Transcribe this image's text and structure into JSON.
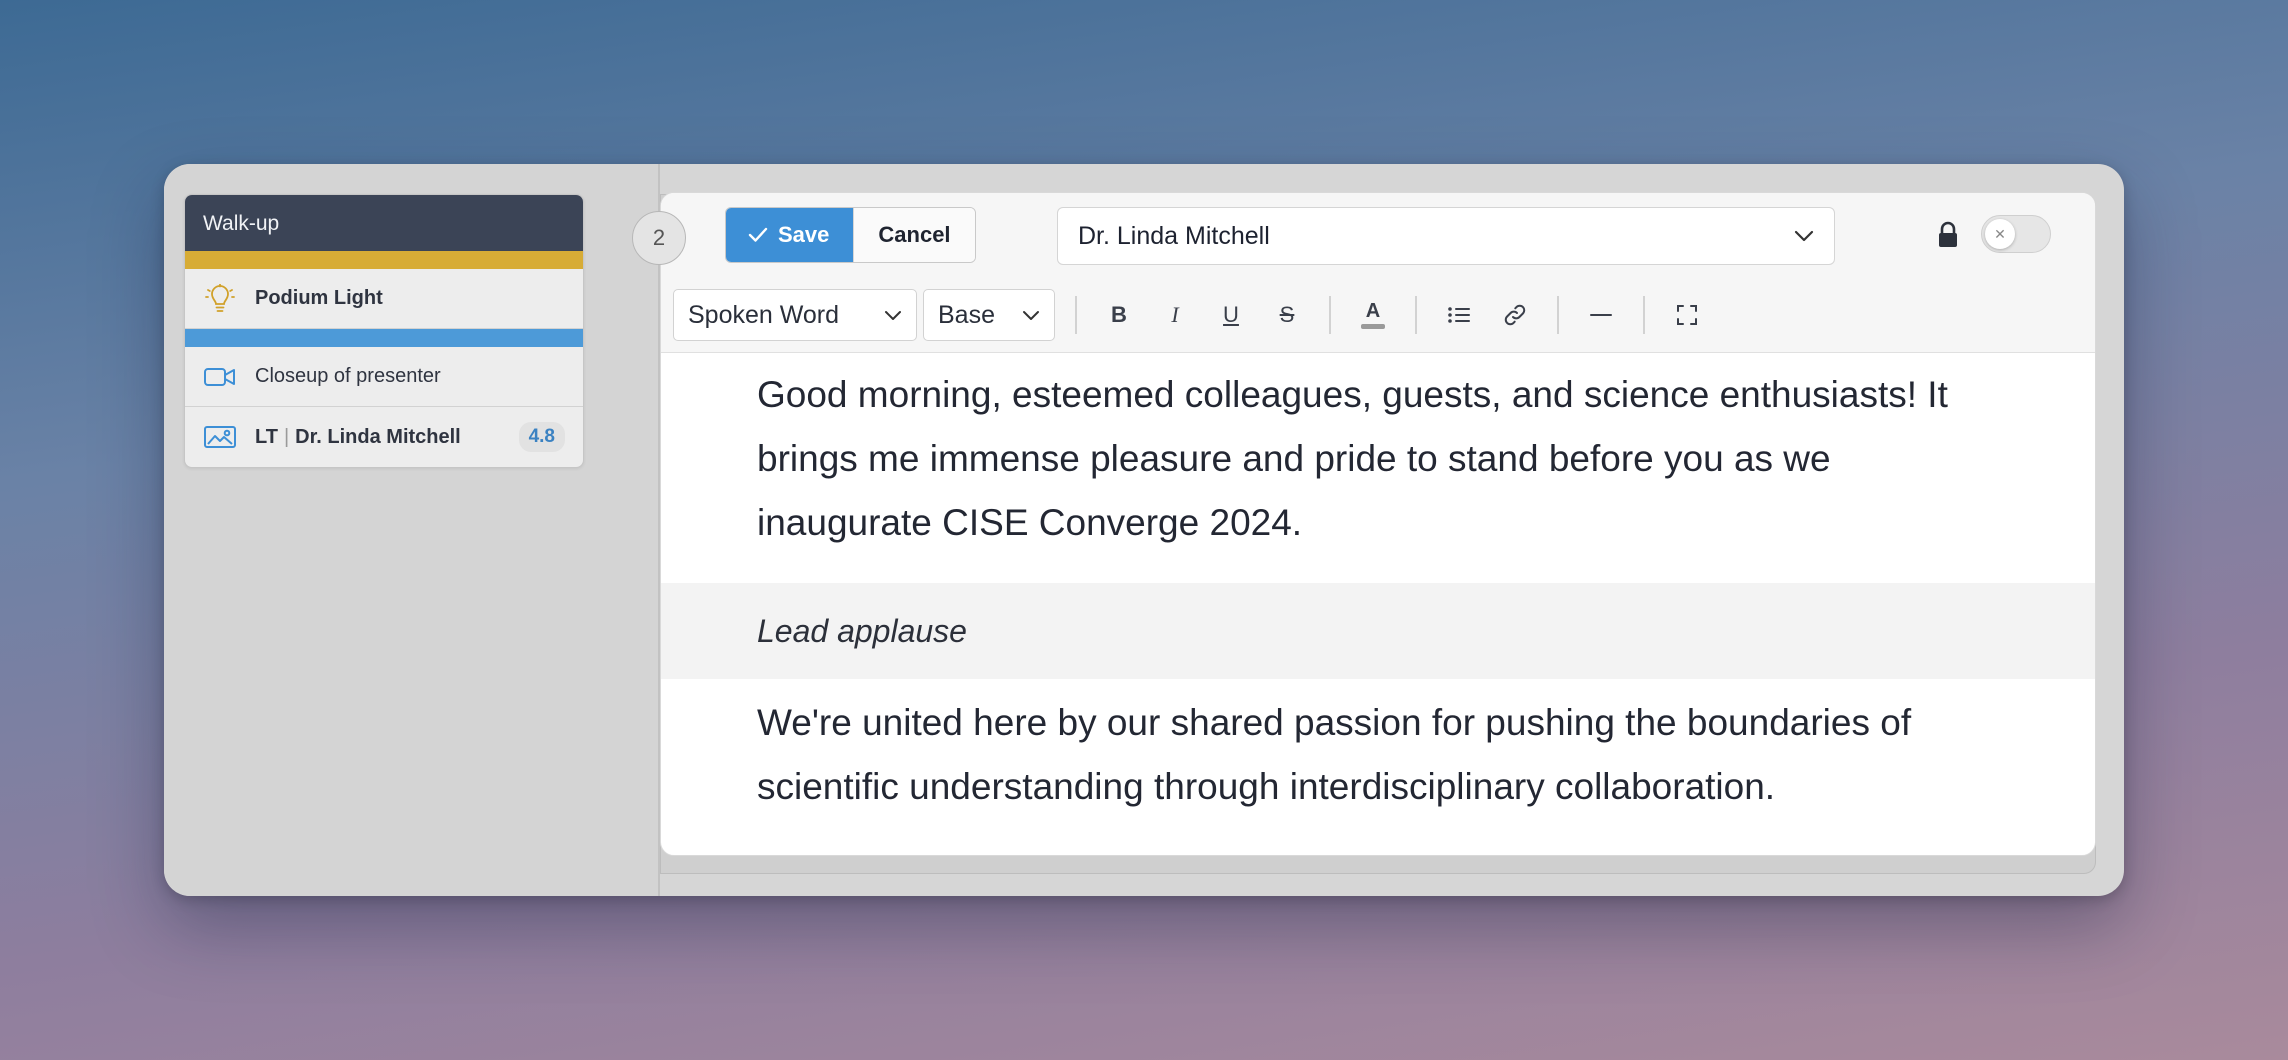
{
  "sidebar": {
    "cue": {
      "header": "Walk-up",
      "rows": [
        {
          "label": "Podium Light",
          "icon": "lightbulb-icon"
        },
        {
          "label": "Closeup of presenter",
          "icon": "video-camera-icon"
        },
        {
          "prefix": "LT",
          "separator": "|",
          "label": "Dr. Linda Mitchell",
          "score": "4.8",
          "icon": "image-icon"
        }
      ]
    }
  },
  "editor": {
    "page_number": "2",
    "save_label": "Save",
    "cancel_label": "Cancel",
    "speaker": "Dr. Linda Mitchell",
    "style_select": "Spoken Word",
    "size_select": "Base",
    "paragraph_1": "Good morning, esteemed colleagues, guests, and science enthusiasts! It brings me immense pleasure and pride to stand before you as we inaugurate CISE Converge 2024.",
    "direction": "Lead applause",
    "paragraph_2": "We're united here by our shared passion for pushing the boundaries of scientific understanding through interdisciplinary collaboration.",
    "toolbar_buttons": {
      "bold": "B",
      "italic": "I",
      "underline": "U",
      "strike": "S",
      "color": "A"
    }
  },
  "colors": {
    "accent": "#3d8fd6",
    "cue_header": "#3b4456",
    "bar_yellow": "#d7ac36",
    "bar_blue": "#4d9ad8"
  }
}
